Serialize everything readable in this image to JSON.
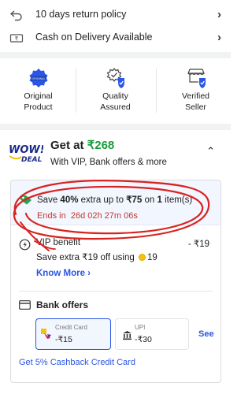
{
  "policies": [
    {
      "label": "10 days return policy",
      "icon": "return-arrow-icon"
    },
    {
      "label": "Cash on Delivery Available",
      "icon": "cash-note-icon"
    }
  ],
  "assurances": [
    {
      "label_line1": "Original",
      "label_line2": "Product",
      "icon": "original-badge-icon"
    },
    {
      "label_line1": "Quality",
      "label_line2": "Assured",
      "icon": "quality-shield-icon"
    },
    {
      "label_line1": "Verified",
      "label_line2": "Seller",
      "icon": "verified-store-icon"
    }
  ],
  "deal": {
    "logo_line1": "WOW!",
    "logo_line2": "DEAL",
    "title_prefix": "Get at",
    "price": "₹268",
    "subtitle": "With VIP, Bank offers & more"
  },
  "offer": {
    "text_pre": "Save ",
    "percent": "40%",
    "text_mid": " extra up to ",
    "amount": "₹75",
    "text_on": " on ",
    "qty": "1",
    "text_post": " item(s)",
    "ends_label": "Ends in",
    "countdown": "26d 02h 27m 06s"
  },
  "vip": {
    "title": "VIP benefit",
    "amount": "- ₹19",
    "sub_prefix": "Save extra ₹19 off using",
    "coins": "19",
    "know_more": "Know More"
  },
  "bank": {
    "title": "Bank offers",
    "options": [
      {
        "label": "Credit Card",
        "value": "-₹15",
        "selected": true
      },
      {
        "label": "UPI",
        "value": "-₹30",
        "selected": false
      }
    ],
    "see": "See",
    "cashback_link": "Get 5% Cashback Credit Card"
  },
  "colors": {
    "price_green": "#1a9a3a",
    "link_blue": "#2a55e5",
    "annotation_red": "#d9231f",
    "offer_bg": "#f2f6ff"
  }
}
